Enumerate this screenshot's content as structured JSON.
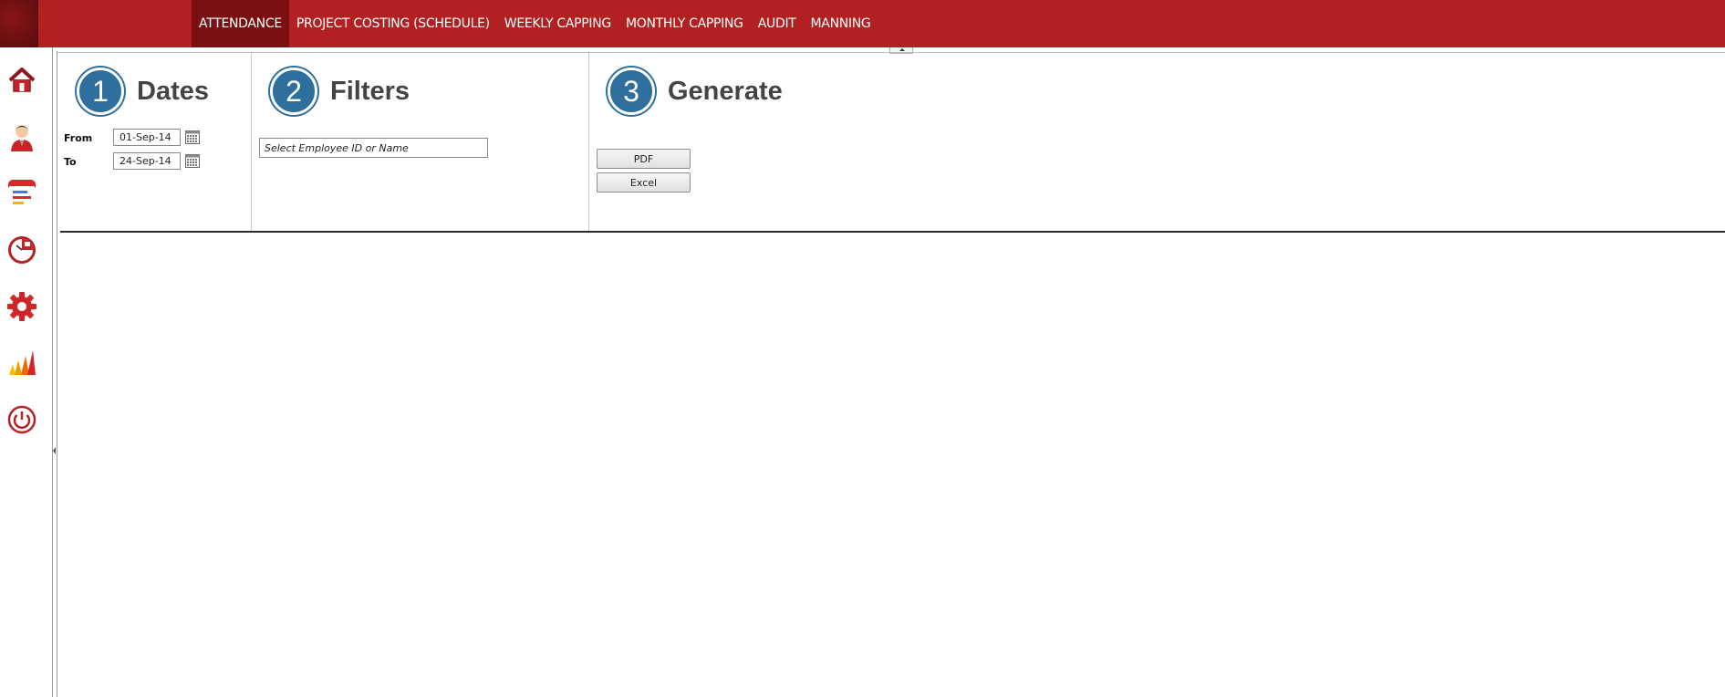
{
  "nav": {
    "items": [
      {
        "label": "ATTENDANCE",
        "active": true
      },
      {
        "label": "PROJECT COSTING (SCHEDULE)",
        "active": false
      },
      {
        "label": "WEEKLY CAPPING",
        "active": false
      },
      {
        "label": "MONTHLY CAPPING",
        "active": false
      },
      {
        "label": "AUDIT",
        "active": false
      },
      {
        "label": "MANNING",
        "active": false
      }
    ]
  },
  "sidebar": {
    "icons": [
      "home-icon",
      "user-icon",
      "schedule-icon",
      "timesheet-clock-icon",
      "settings-gear-icon",
      "reports-chart-icon",
      "power-icon"
    ]
  },
  "steps": {
    "dates": {
      "number": "1",
      "title": "Dates"
    },
    "filters": {
      "number": "2",
      "title": "Filters"
    },
    "generate": {
      "number": "3",
      "title": "Generate"
    }
  },
  "dates": {
    "from_label": "From",
    "from_value": "01-Sep-14",
    "to_label": "To",
    "to_value": "24-Sep-14"
  },
  "filters": {
    "employee_placeholder": "Select Employee ID or Name"
  },
  "generate": {
    "pdf_label": "PDF",
    "excel_label": "Excel"
  },
  "colors": {
    "topbar": "#b22022",
    "active_tab": "#7b1012",
    "step_circle": "#2e6f9e"
  }
}
